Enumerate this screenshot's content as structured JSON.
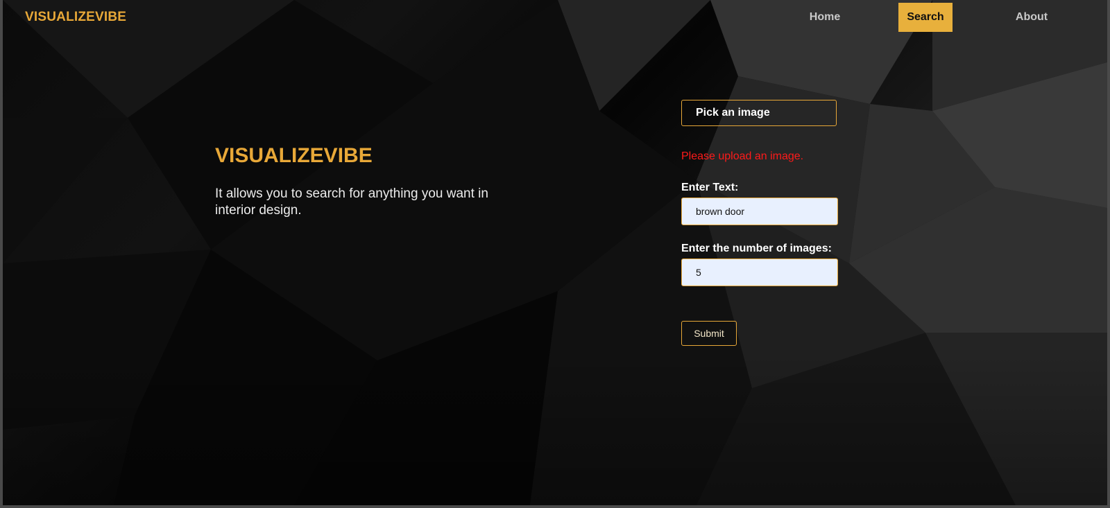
{
  "header": {
    "brand": "VISUALIZEVIBE",
    "nav": [
      {
        "label": "Home"
      },
      {
        "label": "Search"
      },
      {
        "label": "About"
      }
    ],
    "active_nav": "Search"
  },
  "hero": {
    "title": "VISUALIZEVIBE",
    "description": "It allows you to search for anything you want in interior design."
  },
  "form": {
    "pick_image_label": "Pick an image",
    "error_message": "Please upload an image.",
    "text_label": "Enter Text:",
    "text_value": "brown door",
    "count_label": "Enter the number of images:",
    "count_value": "5",
    "submit_label": "Submit"
  },
  "colors": {
    "accent": "#e8a838",
    "error": "#ff1a1a",
    "input_bg": "#e8f0fe"
  }
}
